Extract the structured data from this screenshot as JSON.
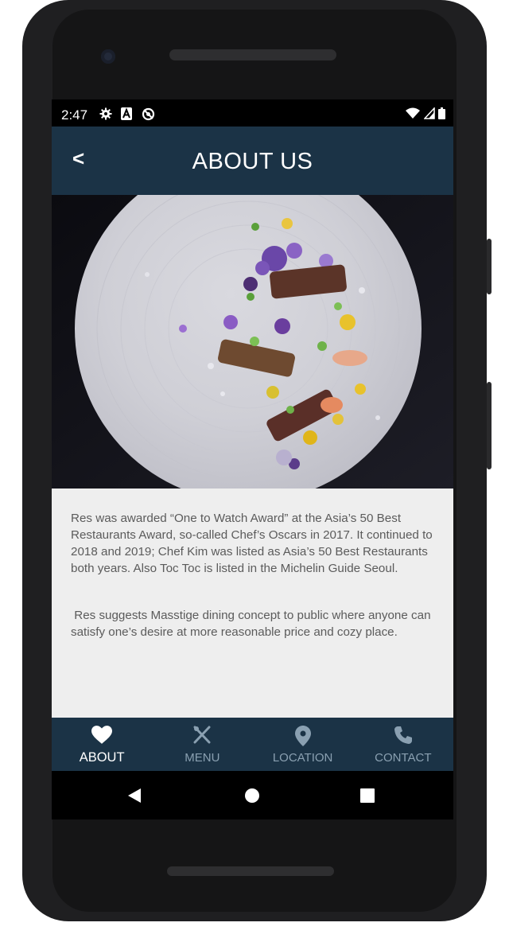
{
  "status": {
    "time": "2:47"
  },
  "header": {
    "back_label": "<",
    "title": "ABOUT US"
  },
  "content": {
    "paragraph1": "Res was awarded “One to Watch Award” at the Asia’s 50 Best Restaurants Award, so-called Chef’s Oscars in 2017. It continued to 2018 and 2019; Chef Kim was listed as Asia’s 50 Best Restaurants both years. Also Toc Toc is listed in the Michelin Guide Seoul.",
    "paragraph2": " Res suggests Masstige dining concept to public where anyone can satisfy one’s desire at more reasonable price and cozy place."
  },
  "nav": {
    "items": [
      {
        "label": "ABOUT",
        "icon": "heart-icon",
        "active": true
      },
      {
        "label": "MENU",
        "icon": "cutlery-icon",
        "active": false
      },
      {
        "label": "LOCATION",
        "icon": "location-pin-icon",
        "active": false
      },
      {
        "label": "CONTACT",
        "icon": "phone-icon",
        "active": false
      }
    ]
  },
  "colors": {
    "appbar": "#1b3346",
    "content_bg": "#eeeeee",
    "inactive_nav": "#8aa0b1"
  }
}
